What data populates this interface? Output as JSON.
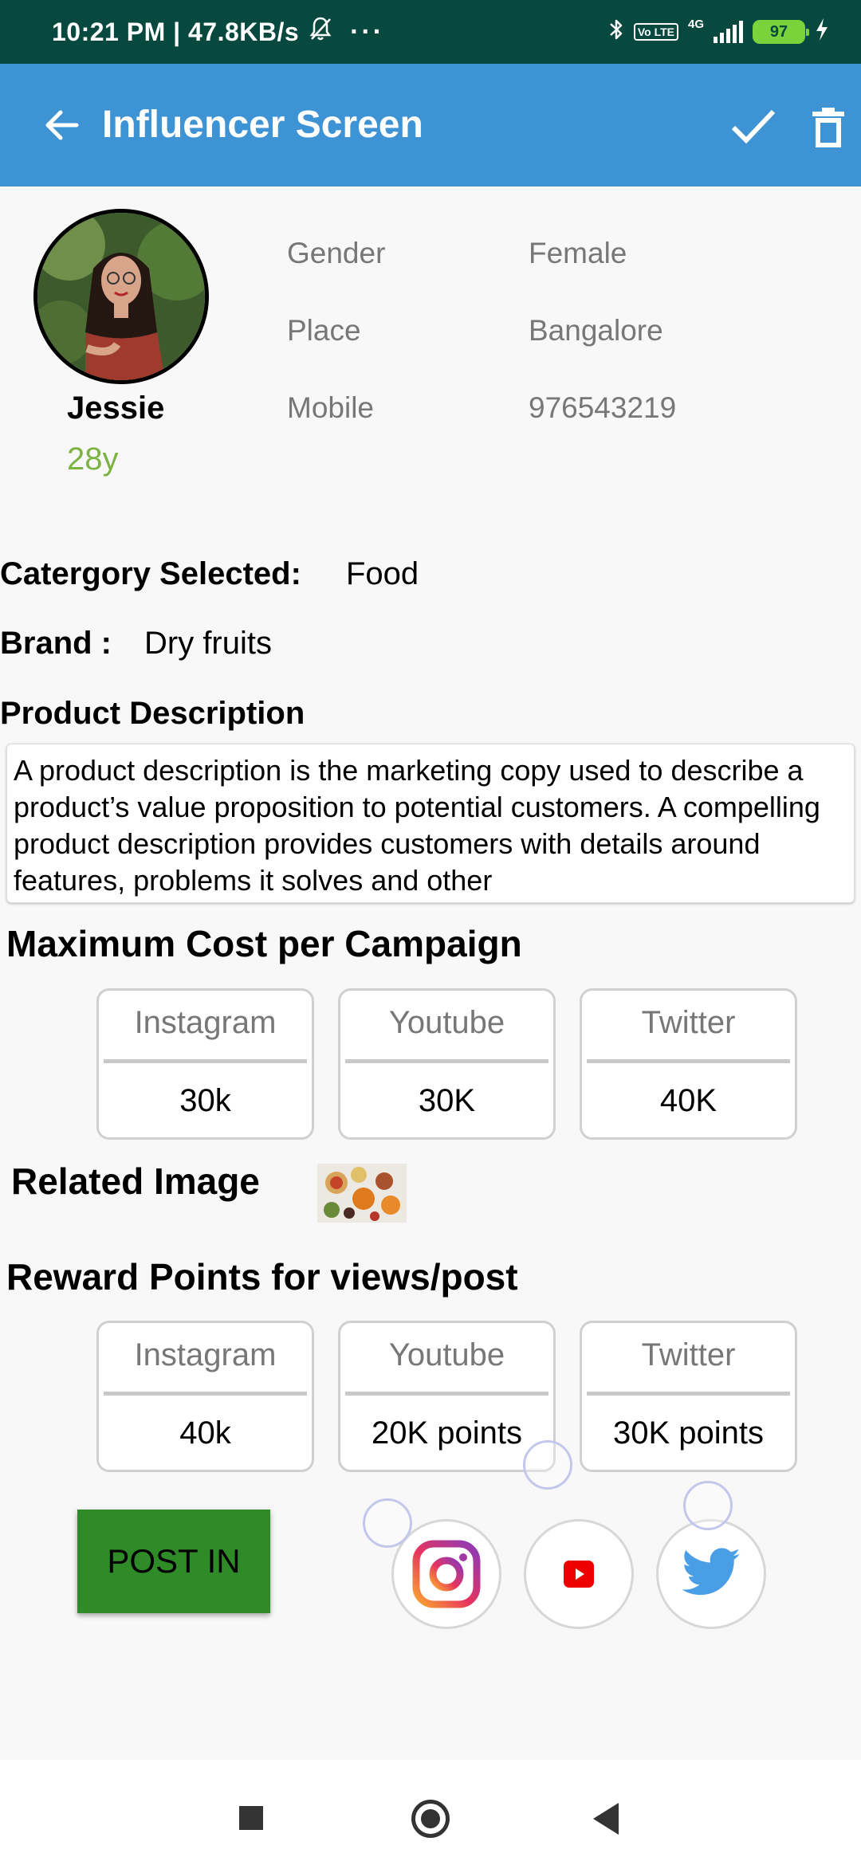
{
  "status_bar": {
    "time_speed": "10:21 PM | 47.8KB/s",
    "more": "···",
    "volte": "Vo LTE",
    "network": "4G",
    "battery": "97"
  },
  "app_bar": {
    "title": "Influencer Screen",
    "color": "#3e93d4"
  },
  "profile": {
    "name": "Jessie",
    "age": "28y",
    "age_color": "#7cb342",
    "details": [
      {
        "label": "Gender",
        "value": "Female"
      },
      {
        "label": "Place",
        "value": "Bangalore"
      },
      {
        "label": "Mobile",
        "value": "976543219"
      }
    ]
  },
  "category": {
    "label": "Catergory Selected:",
    "value": "Food"
  },
  "brand": {
    "label": "Brand :",
    "value": "Dry fruits"
  },
  "product_description": {
    "label": "Product Description",
    "text": "A product description is the marketing copy used to describe a product’s value proposition to potential customers. A compelling product description provides customers with details around features, problems it solves and other"
  },
  "max_cost": {
    "title": "Maximum Cost per Campaign",
    "cards": [
      {
        "platform": "Instagram",
        "value": "30k"
      },
      {
        "platform": "Youtube",
        "value": "30K"
      },
      {
        "platform": "Twitter",
        "value": "40K"
      }
    ]
  },
  "related_image": {
    "label": "Related Image"
  },
  "reward_points": {
    "title": "Reward Points for views/post",
    "cards": [
      {
        "platform": "Instagram",
        "value": "40k"
      },
      {
        "platform": "Youtube",
        "value": "20K points"
      },
      {
        "platform": "Twitter",
        "value": "30K points"
      }
    ]
  },
  "post_button": {
    "label": "POST IN",
    "color": "#2e8b28"
  },
  "social_icons": [
    "instagram-icon",
    "youtube-icon",
    "twitter-icon"
  ]
}
